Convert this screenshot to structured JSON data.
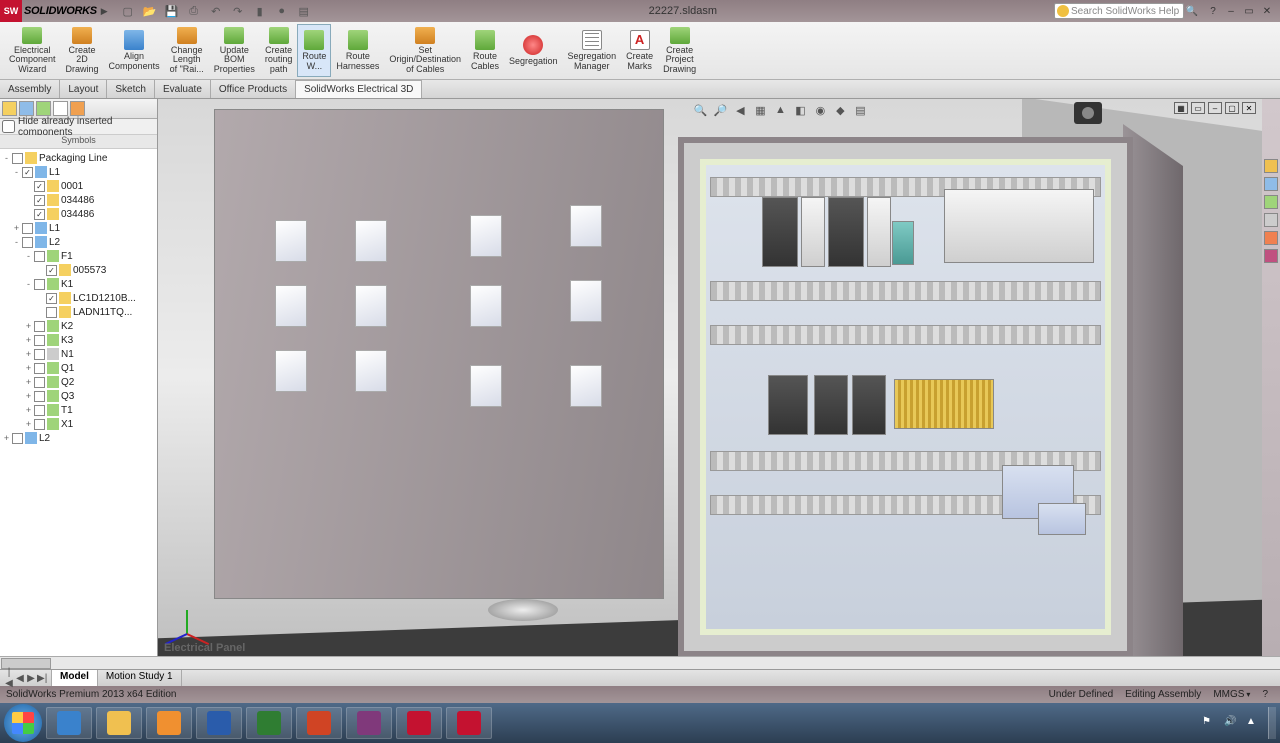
{
  "app": {
    "name": "SOLIDWORKS",
    "doc_title": "22227.sldasm"
  },
  "search": {
    "placeholder": "Search SolidWorks Help"
  },
  "qat": [
    "new",
    "open",
    "save",
    "print",
    "undo",
    "redo",
    "select",
    "rebuild",
    "options"
  ],
  "ribbon": [
    {
      "label": "Electrical\nComponent\nWizard",
      "icon": "green"
    },
    {
      "label": "Create\n2D\nDrawing",
      "icon": "orange"
    },
    {
      "label": "Align\nComponents",
      "icon": "blue"
    },
    {
      "label": "Change\nLength\nof \"Rai...",
      "icon": "orange"
    },
    {
      "label": "Update\nBOM\nProperties",
      "icon": "green"
    },
    {
      "label": "Create\nrouting\npath",
      "icon": "green"
    },
    {
      "label": "Route\nW...",
      "icon": "green",
      "active": true
    },
    {
      "label": "Route\nHarnesses",
      "icon": "green"
    },
    {
      "label": "Set\nOrigin/Destination\nof Cables",
      "icon": "orange"
    },
    {
      "label": "Route\nCables",
      "icon": "green"
    },
    {
      "label": "Segregation",
      "icon": "red"
    },
    {
      "label": "Segregation\nManager",
      "icon": "grid"
    },
    {
      "label": "Create\nMarks",
      "icon": "a"
    },
    {
      "label": "Create\nProject\nDrawing",
      "icon": "green"
    }
  ],
  "tabs": [
    "Assembly",
    "Layout",
    "Sketch",
    "Evaluate",
    "Office Products",
    "SolidWorks Electrical 3D"
  ],
  "tabs_active": 5,
  "left": {
    "hide_label": "Hide already inserted components",
    "symbols_header": "Symbols"
  },
  "tree": [
    {
      "d": 0,
      "exp": "-",
      "cb": "",
      "ic": "y",
      "label": "Packaging Line"
    },
    {
      "d": 1,
      "exp": "-",
      "cb": "✓",
      "ic": "bl",
      "label": "L1"
    },
    {
      "d": 2,
      "exp": "",
      "cb": "✓",
      "ic": "y",
      "label": "0001"
    },
    {
      "d": 2,
      "exp": "",
      "cb": "✓",
      "ic": "y",
      "label": "034486"
    },
    {
      "d": 2,
      "exp": "",
      "cb": "✓",
      "ic": "y",
      "label": "034486"
    },
    {
      "d": 1,
      "exp": "+",
      "cb": "",
      "ic": "bl",
      "label": "L1"
    },
    {
      "d": 1,
      "exp": "-",
      "cb": "",
      "ic": "bl",
      "label": "L2"
    },
    {
      "d": 2,
      "exp": "-",
      "cb": "",
      "ic": "g",
      "label": "F1"
    },
    {
      "d": 3,
      "exp": "",
      "cb": "✓",
      "ic": "y",
      "label": "005573"
    },
    {
      "d": 2,
      "exp": "-",
      "cb": "",
      "ic": "g",
      "label": "K1"
    },
    {
      "d": 3,
      "exp": "",
      "cb": "✓",
      "ic": "y",
      "label": "LC1D1210B..."
    },
    {
      "d": 3,
      "exp": "",
      "cb": "",
      "ic": "y",
      "label": "LADN11TQ..."
    },
    {
      "d": 2,
      "exp": "+",
      "cb": "",
      "ic": "g",
      "label": "K2"
    },
    {
      "d": 2,
      "exp": "+",
      "cb": "",
      "ic": "g",
      "label": "K3"
    },
    {
      "d": 2,
      "exp": "+",
      "cb": "",
      "ic": "gr",
      "label": "N1"
    },
    {
      "d": 2,
      "exp": "+",
      "cb": "",
      "ic": "g",
      "label": "Q1"
    },
    {
      "d": 2,
      "exp": "+",
      "cb": "",
      "ic": "g",
      "label": "Q2"
    },
    {
      "d": 2,
      "exp": "+",
      "cb": "",
      "ic": "g",
      "label": "Q3"
    },
    {
      "d": 2,
      "exp": "+",
      "cb": "",
      "ic": "g",
      "label": "T1"
    },
    {
      "d": 2,
      "exp": "+",
      "cb": "",
      "ic": "g",
      "label": "X1"
    },
    {
      "d": 0,
      "exp": "+",
      "cb": "",
      "ic": "bl",
      "label": "L2"
    }
  ],
  "viewport": {
    "label": "Electrical Panel"
  },
  "door_buttons": [
    [
      60,
      110
    ],
    [
      140,
      110
    ],
    [
      255,
      105
    ],
    [
      355,
      95
    ],
    [
      60,
      175
    ],
    [
      140,
      175
    ],
    [
      255,
      175
    ],
    [
      355,
      170
    ],
    [
      60,
      240
    ],
    [
      140,
      240
    ],
    [
      255,
      255
    ],
    [
      355,
      255
    ]
  ],
  "bottom_tabs": {
    "items": [
      "Model",
      "Motion Study 1"
    ],
    "active": 0
  },
  "status": {
    "left": "SolidWorks Premium 2013 x64 Edition",
    "defined": "Under Defined",
    "mode": "Editing Assembly",
    "units": "MMGS"
  },
  "taskbar_apps": [
    {
      "name": "internet-explorer",
      "color": "#3a82cc"
    },
    {
      "name": "file-explorer",
      "color": "#f0c050"
    },
    {
      "name": "outlook",
      "color": "#f09030"
    },
    {
      "name": "word",
      "color": "#2a5cab"
    },
    {
      "name": "excel",
      "color": "#2f7d32"
    },
    {
      "name": "powerpoint",
      "color": "#d04424"
    },
    {
      "name": "onenote",
      "color": "#80397b"
    },
    {
      "name": "solidworks-1",
      "color": "#c41230"
    },
    {
      "name": "solidworks-2",
      "color": "#c41230"
    }
  ]
}
